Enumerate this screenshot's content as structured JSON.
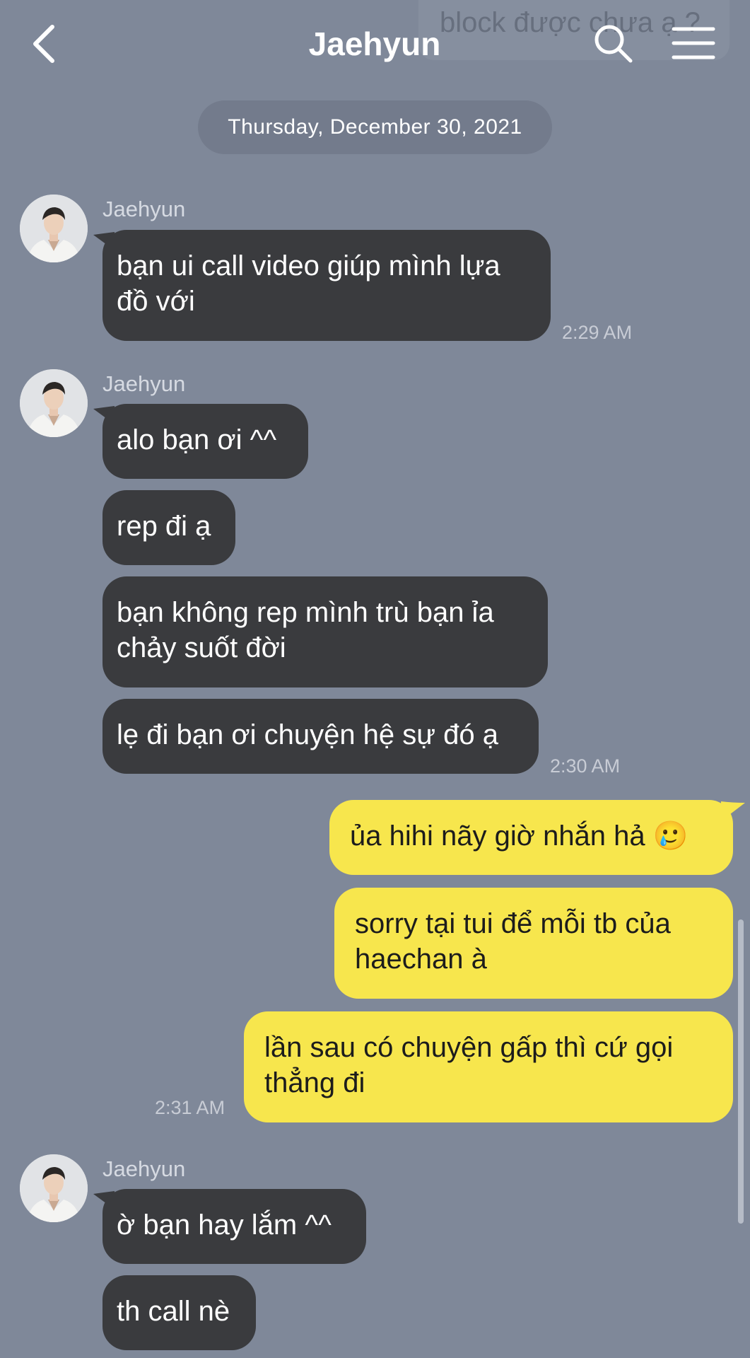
{
  "header": {
    "title": "Jaehyun",
    "peek_text": "block được chưa ạ ?",
    "icons": [
      "back-icon",
      "search-icon",
      "menu-icon"
    ]
  },
  "date_separator": "Thursday, December 30, 2021",
  "colors": {
    "background": "#7f8899",
    "incoming_bubble": "#3a3b3e",
    "outgoing_bubble": "#f7e64d"
  },
  "messages": [
    {
      "sender": "Jaehyun",
      "direction": "incoming",
      "text_lines": [
        "bạn ui call video giúp mình lựa",
        "đồ với"
      ],
      "time": "2:29 AM"
    },
    {
      "sender": "Jaehyun",
      "direction": "incoming",
      "text_lines": [
        "alo bạn ơi ^^"
      ]
    },
    {
      "direction": "incoming",
      "text_lines": [
        "rep đi ạ"
      ]
    },
    {
      "direction": "incoming",
      "text_lines": [
        "bạn không rep mình trù bạn ỉa",
        "chảy suốt đời"
      ]
    },
    {
      "direction": "incoming",
      "text_lines": [
        "lẹ đi bạn ơi chuyện hệ sự đó ạ"
      ],
      "time": "2:30 AM"
    },
    {
      "direction": "outgoing",
      "text_lines": [
        "ủa hihi nãy giờ nhắn hả 🥲"
      ]
    },
    {
      "direction": "outgoing",
      "text_lines": [
        "sorry tại tui để mỗi tb của",
        "haechan à"
      ]
    },
    {
      "direction": "outgoing",
      "text_lines": [
        "lần sau có chuyện gấp thì cứ gọi",
        "thẳng đi"
      ],
      "time": "2:31 AM"
    },
    {
      "sender": "Jaehyun",
      "direction": "incoming",
      "text_lines": [
        "ờ bạn hay lắm ^^"
      ]
    },
    {
      "direction": "incoming",
      "text_lines": [
        "th call nè"
      ]
    }
  ]
}
